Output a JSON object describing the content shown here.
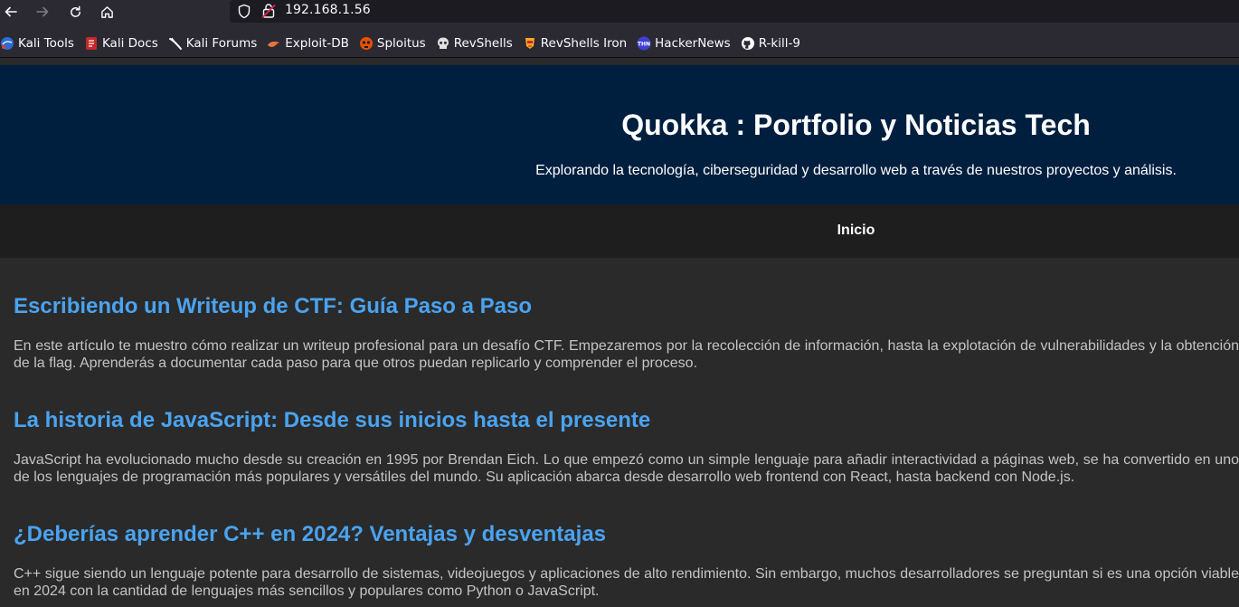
{
  "browser": {
    "url": "192.168.1.56",
    "bookmarks": [
      {
        "label": "Kali Tools",
        "icon": "kali-tools-icon"
      },
      {
        "label": "Kali Docs",
        "icon": "kali-docs-icon"
      },
      {
        "label": "Kali Forums",
        "icon": "kali-forums-icon"
      },
      {
        "label": "Exploit-DB",
        "icon": "exploit-db-icon"
      },
      {
        "label": "Sploitus",
        "icon": "sploitus-icon"
      },
      {
        "label": "RevShells",
        "icon": "skull-icon"
      },
      {
        "label": "RevShells Iron",
        "icon": "iron-icon"
      },
      {
        "label": "HackerNews",
        "icon": "hackernews-icon"
      },
      {
        "label": "R-kill-9",
        "icon": "github-icon"
      }
    ]
  },
  "site": {
    "title": "Quokka : Portfolio y Noticias Tech",
    "subtitle": "Explorando la tecnología, ciberseguridad y desarrollo web a través de nuestros proyectos y análisis.",
    "nav": {
      "home": "Inicio"
    },
    "colors": {
      "header_bg": "#001f3f",
      "nav_bg": "#1e1e1e",
      "heading": "#4aa3f0",
      "body_text": "#c4c4c4"
    }
  },
  "articles": [
    {
      "title": "Escribiendo un Writeup de CTF: Guía Paso a Paso",
      "body": "En este artículo te muestro cómo realizar un writeup profesional para un desafío CTF. Empezaremos por la recolección de información, hasta la explotación de vulnerabilidades y la obtención de la flag. Aprenderás a documentar cada paso para que otros puedan replicarlo y comprender el proceso."
    },
    {
      "title": "La historia de JavaScript: Desde sus inicios hasta el presente",
      "body": "JavaScript ha evolucionado mucho desde su creación en 1995 por Brendan Eich. Lo que empezó como un simple lenguaje para añadir interactividad a páginas web, se ha convertido en uno de los lenguajes de programación más populares y versátiles del mundo. Su aplicación abarca desde desarrollo web frontend con React, hasta backend con Node.js."
    },
    {
      "title": "¿Deberías aprender C++ en 2024? Ventajas y desventajas",
      "body": "C++ sigue siendo un lenguaje potente para desarrollo de sistemas, videojuegos y aplicaciones de alto rendimiento. Sin embargo, muchos desarrolladores se preguntan si es una opción viable en 2024 con la cantidad de lenguajes más sencillos y populares como Python o JavaScript."
    }
  ]
}
